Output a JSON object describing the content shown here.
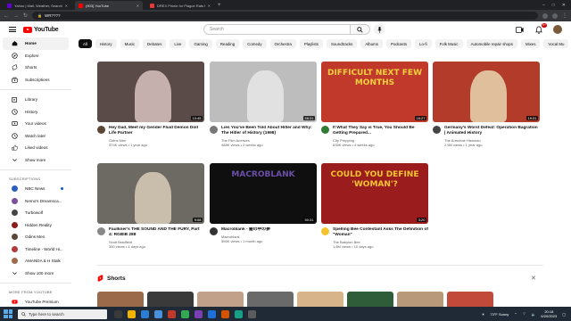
{
  "browser": {
    "tabs": [
      {
        "label": "Yahoo | Mail, Weather, Search, Politics",
        "favicon_color": "#6001d2",
        "active": false
      },
      {
        "label": "(903) YouTube",
        "favicon_color": "#ff0000",
        "active": true
      },
      {
        "label": "DREX Pinnie for Plague Rats P...",
        "favicon_color": "#e53935",
        "active": false
      }
    ],
    "url": "WR????"
  },
  "masthead": {
    "logo_text": "YouTube",
    "search_placeholder": "Search",
    "notification_count": "9+"
  },
  "sidebar": {
    "primary": [
      {
        "label": "Home",
        "icon": "home-icon",
        "active": true
      },
      {
        "label": "Explore",
        "icon": "compass-icon"
      },
      {
        "label": "Shorts",
        "icon": "shorts-icon"
      },
      {
        "label": "Subscriptions",
        "icon": "subscriptions-icon"
      }
    ],
    "library": [
      {
        "label": "Library",
        "icon": "library-icon"
      },
      {
        "label": "History",
        "icon": "history-icon"
      },
      {
        "label": "Your videos",
        "icon": "your-videos-icon"
      },
      {
        "label": "Watch later",
        "icon": "clock-icon"
      },
      {
        "label": "Liked videos",
        "icon": "thumbs-up-icon"
      },
      {
        "label": "Show more",
        "icon": "chevron-down-icon"
      }
    ],
    "subscriptions_heading": "SUBSCRIPTIONS",
    "subscriptions": [
      {
        "label": "NBC News",
        "color": "#2c5ebd",
        "live": true
      },
      {
        "label": "Nemo's Dreamsca...",
        "color": "#7a4f9c",
        "live": true
      },
      {
        "label": "Turbowolf",
        "color": "#444444",
        "live": false
      },
      {
        "label": "Hidden Reality",
        "color": "#8a1c1c",
        "live": false
      },
      {
        "label": "Odins Men",
        "color": "#5b4636",
        "live": false
      },
      {
        "label": "Timeline - World Hi...",
        "color": "#b33a3a",
        "live": true
      },
      {
        "label": "AMANDA & H Stalk",
        "color": "#a06b4d",
        "live": false
      },
      {
        "label": "Show 100 more",
        "color": "",
        "live": false
      }
    ],
    "more_heading": "MORE FROM YOUTUBE",
    "more": [
      {
        "label": "YouTube Premium",
        "icon": "youtube-premium-icon"
      }
    ]
  },
  "chips": [
    "All",
    "History",
    "Music",
    "Debates",
    "Live",
    "Gaming",
    "Reading",
    "Comedy",
    "Orchestra",
    "Playlists",
    "Soundtracks",
    "Albums",
    "Podcasts",
    "Lo-fi",
    "Folk Music",
    "Automobile repair shops",
    "Mixes",
    "Vocal Mu"
  ],
  "videos": [
    {
      "title": "Hey Dad, Meet my Gender Fluid Demon Doll Life Partner",
      "channel": "Odins Men",
      "stats": "374K views • 1 year ago",
      "duration": "10:45",
      "thumb_bg": "#5a4a48",
      "thumb_accent": "#d8c2c0",
      "avatar": "#5b4636"
    },
    {
      "title": "Lies You've Been Told About Hitler and Why: The Hitler of History (1998)",
      "channel": "The Film Archives",
      "stats": "488K views • 2 weeks ago",
      "duration": "58:31",
      "thumb_bg": "#bdbdbd",
      "thumb_accent": "#e8e8e8",
      "avatar": "#777777"
    },
    {
      "title": "If What They Say is True, You Should Be Getting Prepared...",
      "channel": "City Prepping",
      "stats": "635K views • 4 weeks ago",
      "duration": "16:27",
      "thumb_bg": "#c0392b",
      "thumb_accent": "#f4d03f",
      "avatar": "#2e7d32",
      "thumb_text": "DIFFICULT NEXT FEW MONTHS"
    },
    {
      "title": "Germany's Worst Defeat: Operation Bagration | Animated History",
      "channel": "The Armchair Historian",
      "stats": "2.5M views • 1 year ago",
      "duration": "19:31",
      "thumb_bg": "#b23b2a",
      "thumb_accent": "#e8d7b0",
      "avatar": "#444444"
    },
    {
      "title": "Faulkner's THE SOUND AND THE FURY, Part 4: RGBIB 288",
      "channel": "Scott Bradfield",
      "stats": "350 views • 4 days ago",
      "duration": "9:08",
      "thumb_bg": "#6d6a63",
      "thumb_accent": "#d9cbb9",
      "avatar": "#888888"
    },
    {
      "title": "Macroblank - 闇の中の夢",
      "channel": "Macroblank",
      "stats": "555K views • 1 month ago",
      "duration": "50:31",
      "thumb_bg": "#0f0f0f",
      "thumb_accent": "#6a4fa8",
      "avatar": "#333333",
      "thumb_text": "MACROBLANK"
    },
    {
      "title": "Spelling Bee Contestant Asks The Definition of \"Woman\"",
      "channel": "The Babylon Bee",
      "stats": "1.6M views • 10 days ago",
      "duration": "3:20",
      "thumb_bg": "#9b1c1c",
      "thumb_accent": "#f4c430",
      "avatar": "#f4c430",
      "thumb_text": "COULD YOU DEFINE 'WOMAN'?"
    }
  ],
  "shorts": {
    "title": "Shorts",
    "tiles": [
      "#9a6a4a",
      "#3a3a3a",
      "#c2a18a",
      "#6a6a6a",
      "#d8b48a",
      "#2f5d3a",
      "#b89a7a",
      "#c14a3a"
    ]
  },
  "taskbar": {
    "search_placeholder": "Type here to search",
    "weather": "73°F  Sunny",
    "time": "20:18",
    "date": "6/20/2023"
  }
}
